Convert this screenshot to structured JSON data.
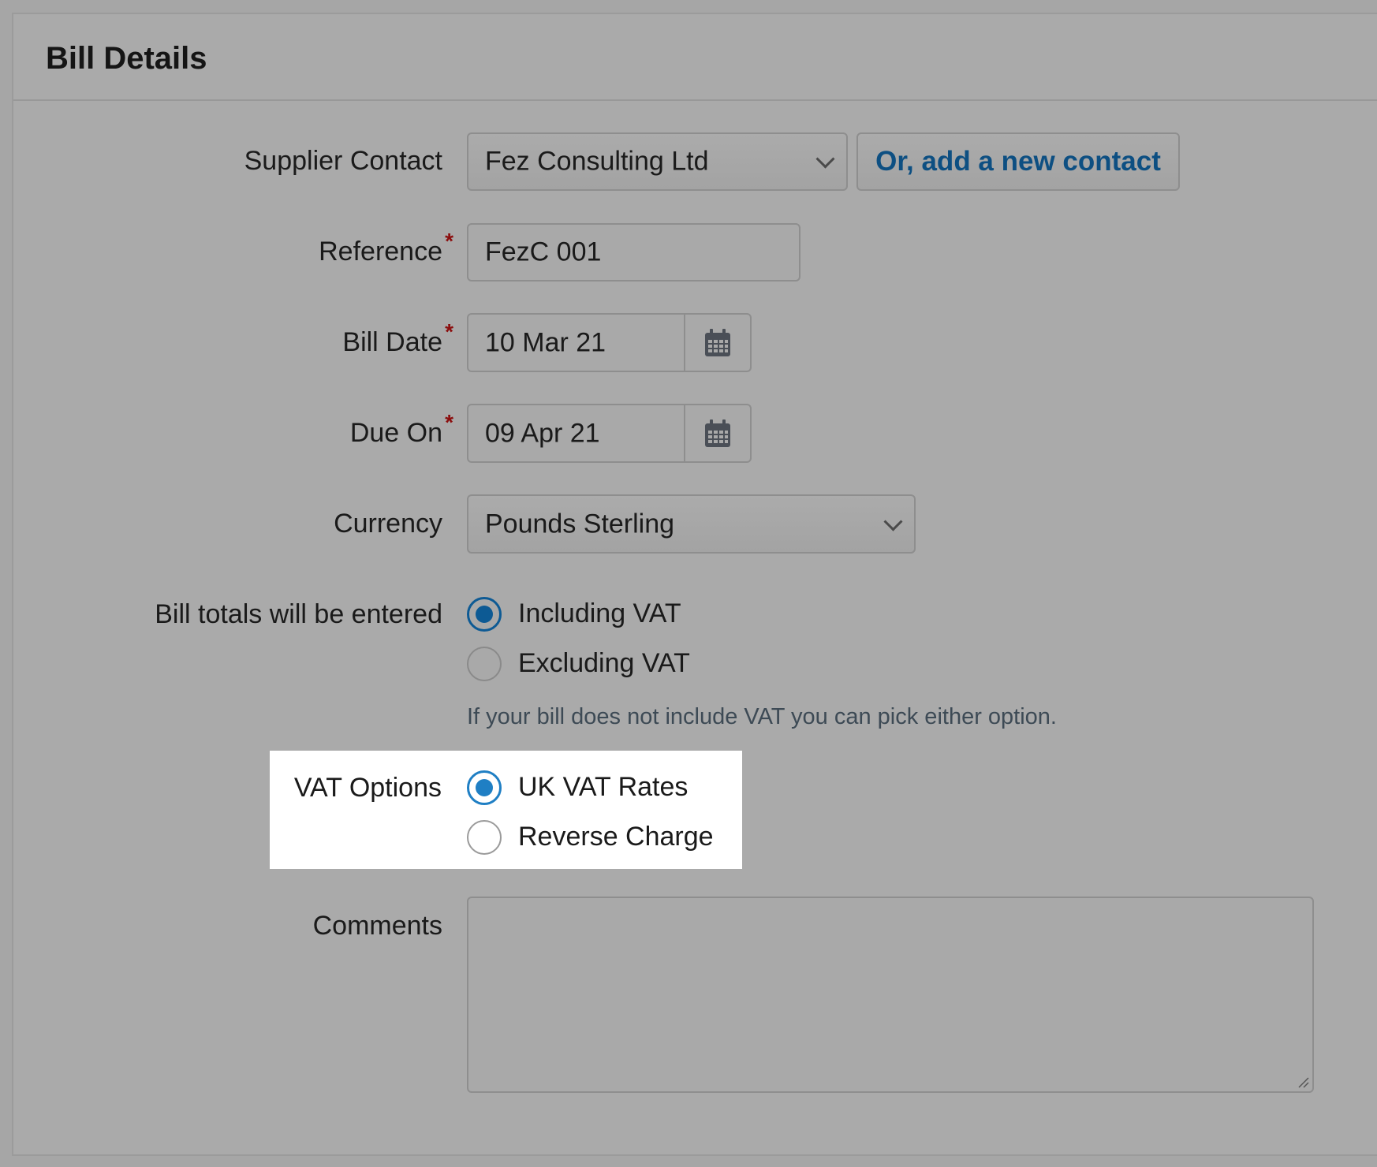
{
  "panel": {
    "title": "Bill Details"
  },
  "form": {
    "supplier_contact": {
      "label": "Supplier Contact",
      "value": "Fez Consulting Ltd",
      "add_link": "Or, add a new contact"
    },
    "reference": {
      "label": "Reference",
      "value": "FezC 001"
    },
    "bill_date": {
      "label": "Bill Date",
      "value": "10 Mar 21"
    },
    "due_on": {
      "label": "Due On",
      "value": "09 Apr 21"
    },
    "currency": {
      "label": "Currency",
      "value": "Pounds Sterling"
    },
    "bill_totals": {
      "label": "Bill totals will be entered",
      "options": [
        "Including VAT",
        "Excluding VAT"
      ],
      "selected": "Including VAT",
      "hint": "If your bill does not include VAT you can pick either option."
    },
    "vat_options": {
      "label": "VAT Options",
      "options": [
        "UK VAT Rates",
        "Reverse Charge"
      ],
      "selected": "UK VAT Rates"
    },
    "comments": {
      "label": "Comments",
      "value": ""
    }
  },
  "icons": {
    "calendar": "calendar-icon",
    "dropdown": "chevron-down-icon",
    "resize": "resize-handle-icon"
  },
  "colors": {
    "accent": "#0d5a94",
    "link": "#0d4f82",
    "required": "#8b0d0d",
    "highlight_bg": "#ffffff"
  }
}
